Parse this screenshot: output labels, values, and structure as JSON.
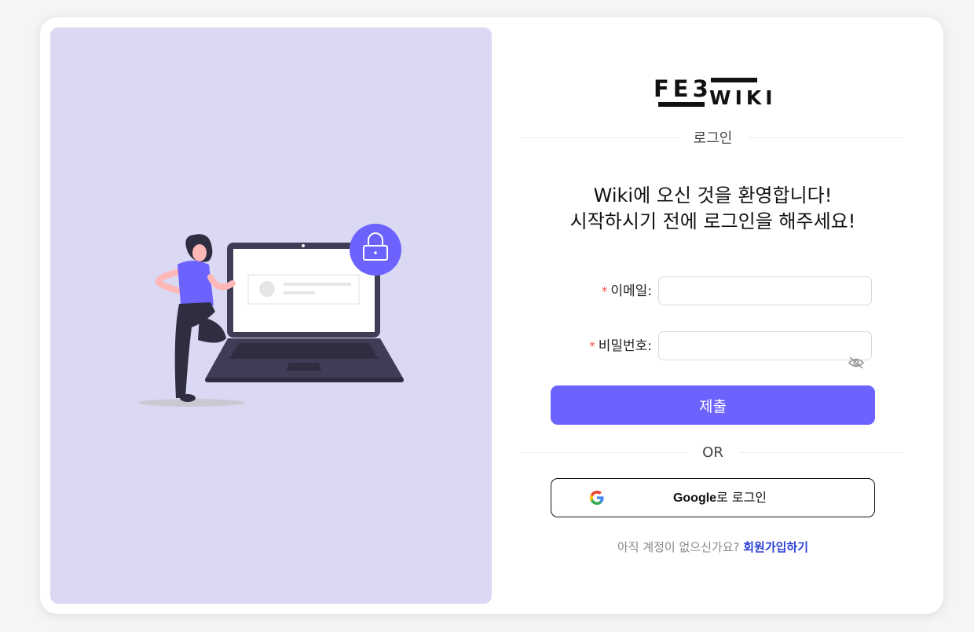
{
  "logo": {
    "text_top": "FE3",
    "text_bottom": "WIKI"
  },
  "login_title": "로그인",
  "welcome": {
    "line1": "Wiki에 오신 것을 환영합니다!",
    "line2": "시작하시기 전에 로그인을 해주세요!"
  },
  "form": {
    "required_mark": "*",
    "email_label": "이메일:",
    "email_value": "",
    "password_label": "비밀번호:",
    "password_value": "",
    "submit_label": "제출"
  },
  "or_divider": "OR",
  "google": {
    "brand": "Google",
    "suffix": "로 로그인",
    "icon": "google-g-icon"
  },
  "signup": {
    "prompt": "아직 계정이 없으신가요?",
    "link": "회원가입하기"
  },
  "colors": {
    "accent": "#6c63ff",
    "left_panel": "#dad8f2",
    "link": "#2b3fd6",
    "required": "#ff4d4f"
  },
  "icons": {
    "lock": "lock-icon",
    "eye_hidden": "eye-invisible-icon"
  }
}
